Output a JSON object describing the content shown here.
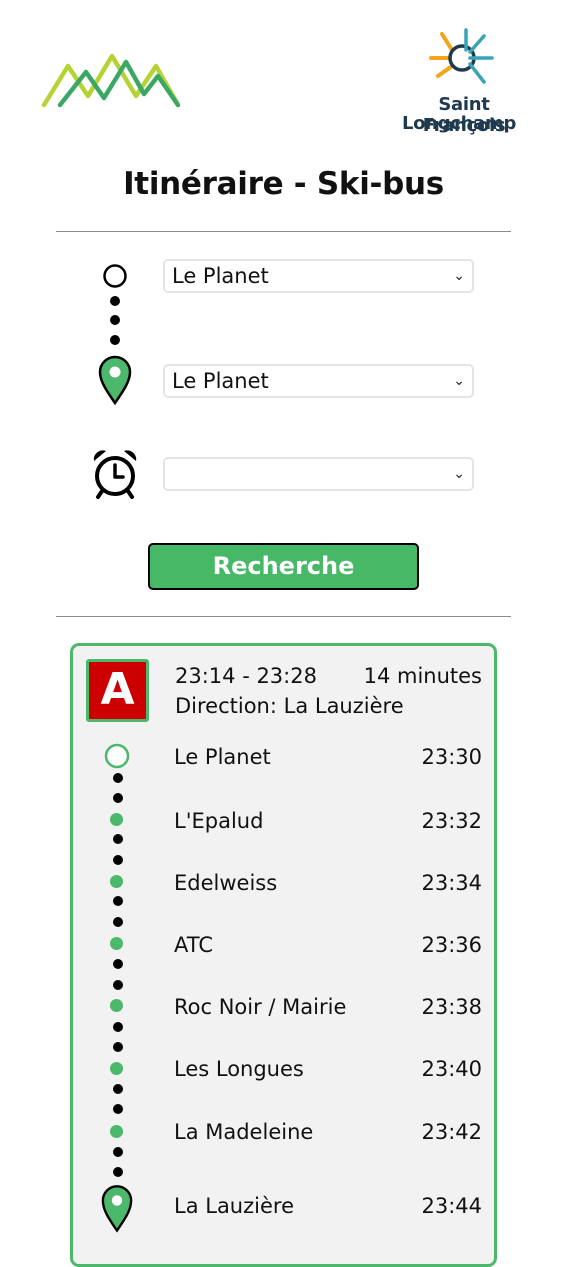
{
  "brand": {
    "name_line1": "Saint François",
    "name_line2": "Longchamp"
  },
  "page": {
    "title": "Itinéraire - Ski-bus"
  },
  "form": {
    "origin_value": "Le Planet",
    "destination_value": "Le Planet",
    "time_value": "",
    "search_label": "Recherche"
  },
  "result": {
    "line": "A",
    "time_range": "23:14 - 23:28",
    "duration": "14 minutes",
    "direction": "Direction: La Lauzière",
    "stops": [
      {
        "name": "Le Planet",
        "time": "23:30"
      },
      {
        "name": "L'Epalud",
        "time": "23:32"
      },
      {
        "name": "Edelweiss",
        "time": "23:34"
      },
      {
        "name": "ATC",
        "time": "23:36"
      },
      {
        "name": "Roc Noir / Mairie",
        "time": "23:38"
      },
      {
        "name": "Les Longues",
        "time": "23:40"
      },
      {
        "name": "La Madeleine",
        "time": "23:42"
      },
      {
        "name": "La Lauzière",
        "time": "23:44"
      }
    ]
  },
  "colors": {
    "accent_green": "#46b866",
    "line_red": "#cc0000",
    "brand_navy": "#1f3a4f",
    "brand_orange": "#f5a31a",
    "brand_teal": "#3aa3b8"
  }
}
